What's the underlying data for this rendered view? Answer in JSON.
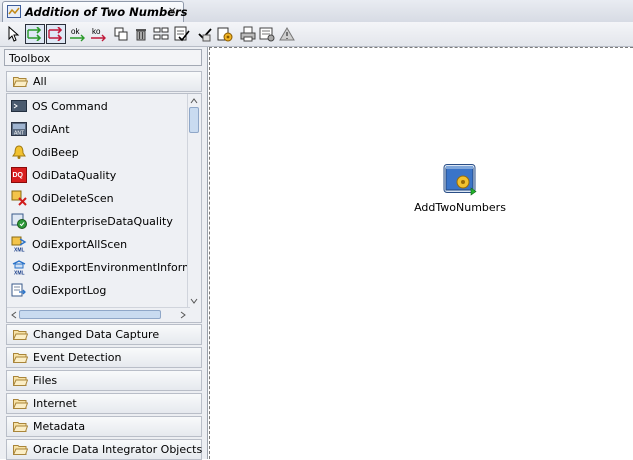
{
  "window": {
    "tab_title": "Addition of Two Numbers",
    "close_glyph": "×"
  },
  "toolbar": {
    "buttons": [
      {
        "name": "select-tool-button",
        "icon": "arrow-cursor-icon"
      },
      {
        "name": "ok-link-button",
        "icon": "green-arrow-icon"
      },
      {
        "name": "ko-link-button",
        "icon": "red-arrow-icon"
      },
      {
        "name": "ok-label-button",
        "icon": "ok-label-icon",
        "text": "ok"
      },
      {
        "name": "ko-label-button",
        "icon": "ko-label-icon",
        "text": "ko"
      },
      {
        "name": "duplicate-button",
        "icon": "duplicate-icon"
      },
      {
        "name": "delete-button",
        "icon": "trash-icon"
      },
      {
        "name": "arrange-button",
        "icon": "arrange-icon"
      },
      {
        "name": "validate-button",
        "icon": "validate-icon"
      },
      {
        "name": "check-button",
        "icon": "check-icon"
      },
      {
        "name": "execute-button",
        "icon": "gear-execute-icon"
      },
      {
        "name": "print-button",
        "icon": "print-icon"
      },
      {
        "name": "properties-button",
        "icon": "properties-icon"
      },
      {
        "name": "warning-button",
        "icon": "warning-icon"
      }
    ]
  },
  "toolbox": {
    "header": "Toolbox",
    "open_category": "All",
    "items": [
      {
        "label": "OS Command",
        "icon": "terminal-icon"
      },
      {
        "label": "OdiAnt",
        "icon": "ant-icon"
      },
      {
        "label": "OdiBeep",
        "icon": "bell-icon"
      },
      {
        "label": "OdiDataQuality",
        "icon": "dataquality-icon"
      },
      {
        "label": "OdiDeleteScen",
        "icon": "delete-scenario-icon"
      },
      {
        "label": "OdiEnterpriseDataQuality",
        "icon": "enterprise-dq-icon"
      },
      {
        "label": "OdiExportAllScen",
        "icon": "xml-export-icon"
      },
      {
        "label": "OdiExportEnvironmentInformatic",
        "icon": "xml-export-icon"
      },
      {
        "label": "OdiExportLog",
        "icon": "export-log-icon"
      }
    ],
    "categories": [
      "Changed Data Capture",
      "Event Detection",
      "Files",
      "Internet",
      "Metadata",
      "Oracle Data Integrator Objects"
    ]
  },
  "canvas": {
    "node": {
      "label": "AddTwoNumbers",
      "icon": "procedure-step-icon"
    }
  },
  "colors": {
    "accent": "#3b6fb6",
    "ok": "#2a9a2a",
    "ko": "#c0193a"
  }
}
